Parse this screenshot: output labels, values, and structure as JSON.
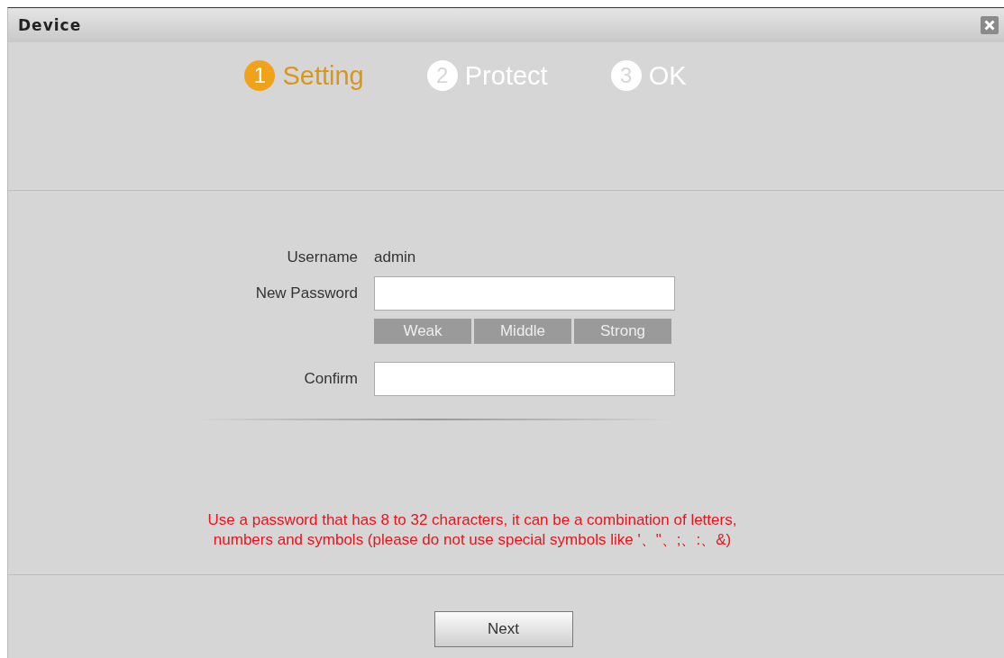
{
  "window": {
    "title": "Device"
  },
  "steps": [
    {
      "number": "1",
      "label": "Setting",
      "selected": true
    },
    {
      "number": "2",
      "label": "Protect",
      "selected": false
    },
    {
      "number": "3",
      "label": "OK",
      "selected": false
    }
  ],
  "form": {
    "username_label": "Username",
    "username": "admin",
    "new_password_label": "New Password",
    "confirm_label": "Confirm"
  },
  "strength": [
    {
      "label": "Weak",
      "lit": false
    },
    {
      "label": "Middle",
      "lit": false
    },
    {
      "label": "Strong",
      "lit": false
    }
  ],
  "hint": "Use a password that has 8 to 32 characters, it can be a combination of letters,\nnumbers and symbols (please do not use special symbols like '、\"、;、:、&)",
  "buttons": [
    "Next"
  ]
}
